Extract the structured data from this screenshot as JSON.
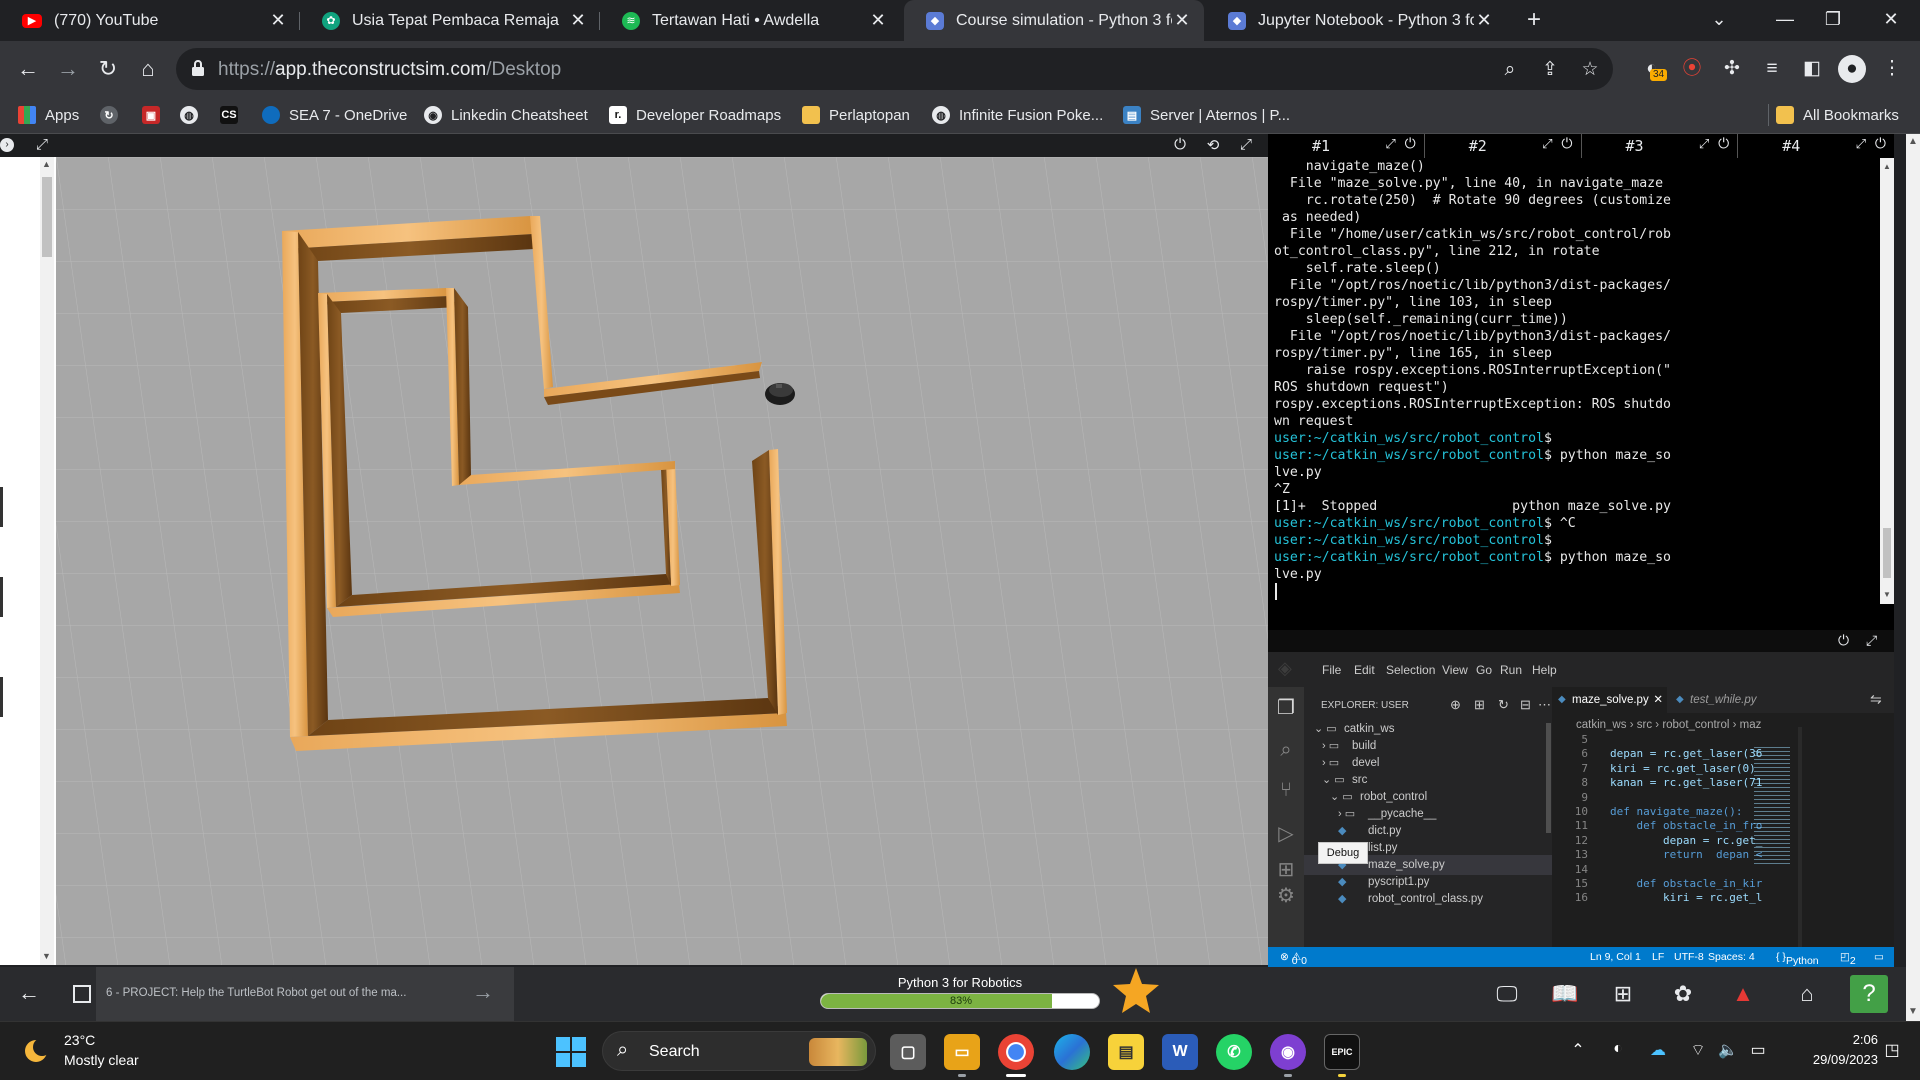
{
  "tabs": [
    {
      "title": "(770) YouTube",
      "icon": "youtube-icon",
      "active": false
    },
    {
      "title": "Usia Tepat Pembaca Remaja",
      "icon": "chatgpt-icon",
      "active": false
    },
    {
      "title": "Tertawan Hati • Awdella",
      "icon": "spotify-icon",
      "active": false
    },
    {
      "title": "Course simulation - Python 3 for",
      "icon": "theconstruct-icon",
      "active": true
    },
    {
      "title": "Jupyter Notebook - Python 3 for",
      "icon": "theconstruct-icon",
      "active": false
    }
  ],
  "address": {
    "scheme": "https://",
    "host": "app.theconstructsim.com",
    "path": "/Desktop"
  },
  "extension_badge": "34",
  "bookmarks": [
    {
      "label": "Apps",
      "icon": "apps-grid-icon"
    },
    {
      "label": "",
      "icon": "refresh-site-icon"
    },
    {
      "label": "",
      "icon": "red-site-icon"
    },
    {
      "label": "",
      "icon": "globe-icon"
    },
    {
      "label": "",
      "icon": "cs-site-icon"
    },
    {
      "label": "SEA 7 - OneDrive",
      "icon": "onedrive-icon"
    },
    {
      "label": "Linkedin Cheatsheet",
      "icon": "github-icon"
    },
    {
      "label": "Developer Roadmaps",
      "icon": "roadmap-icon"
    },
    {
      "label": "Perlaptopan",
      "icon": "folder-icon"
    },
    {
      "label": "Infinite Fusion Poke...",
      "icon": "globe-icon"
    },
    {
      "label": "Server | Aternos | P...",
      "icon": "aternos-icon"
    }
  ],
  "all_bookmarks": "All Bookmarks",
  "terminal": {
    "tabs": [
      "#1",
      "#2",
      "#3",
      "#4"
    ],
    "lines": [
      {
        "text": "    navigate_maze()"
      },
      {
        "text": "  File \"maze_solve.py\", line 40, in navigate_maze"
      },
      {
        "text": "    rc.rotate(250)  # Rotate 90 degrees (customize"
      },
      {
        "text": " as needed)"
      },
      {
        "text": "  File \"/home/user/catkin_ws/src/robot_control/rob"
      },
      {
        "text": "ot_control_class.py\", line 212, in rotate"
      },
      {
        "text": "    self.rate.sleep()"
      },
      {
        "text": "  File \"/opt/ros/noetic/lib/python3/dist-packages/"
      },
      {
        "text": "rospy/timer.py\", line 103, in sleep"
      },
      {
        "text": "    sleep(self._remaining(curr_time))"
      },
      {
        "text": "  File \"/opt/ros/noetic/lib/python3/dist-packages/"
      },
      {
        "text": "rospy/timer.py\", line 165, in sleep"
      },
      {
        "text": "    raise rospy.exceptions.ROSInterruptException(\""
      },
      {
        "text": "ROS shutdown request\")"
      },
      {
        "text": "rospy.exceptions.ROSInterruptException: ROS shutdo"
      },
      {
        "text": "wn request"
      },
      {
        "prompt": "user:~/catkin_ws/src/robot_control",
        "text": "$"
      },
      {
        "prompt": "user:~/catkin_ws/src/robot_control",
        "text": "$ python maze_so"
      },
      {
        "text": "lve.py"
      },
      {
        "text": "^Z"
      },
      {
        "text": "[1]+  Stopped                 python maze_solve.py"
      },
      {
        "prompt": "user:~/catkin_ws/src/robot_control",
        "text": "$ ^C"
      },
      {
        "prompt": "user:~/catkin_ws/src/robot_control",
        "text": "$"
      },
      {
        "prompt": "user:~/catkin_ws/src/robot_control",
        "text": "$ python maze_so"
      },
      {
        "text": "lve.py"
      }
    ]
  },
  "vscode": {
    "menu": [
      "File",
      "Edit",
      "Selection",
      "View",
      "Go",
      "Run",
      "Help"
    ],
    "explorer_title": "EXPLORER: USER",
    "tree": [
      {
        "label": "catkin_ws",
        "depth": 0,
        "kind": "folder-open"
      },
      {
        "label": "build",
        "depth": 1,
        "kind": "folder"
      },
      {
        "label": "devel",
        "depth": 1,
        "kind": "folder"
      },
      {
        "label": "src",
        "depth": 1,
        "kind": "folder-open"
      },
      {
        "label": "robot_control",
        "depth": 2,
        "kind": "folder-open"
      },
      {
        "label": "__pycache__",
        "depth": 3,
        "kind": "folder"
      },
      {
        "label": "dict.py",
        "depth": 3,
        "kind": "file"
      },
      {
        "label": "list.py",
        "depth": 3,
        "kind": "file"
      },
      {
        "label": "maze_solve.py",
        "depth": 3,
        "kind": "file",
        "selected": true
      },
      {
        "label": "pyscript1.py",
        "depth": 3,
        "kind": "file"
      },
      {
        "label": "robot_control_class.py",
        "depth": 3,
        "kind": "file"
      }
    ],
    "tabs": [
      {
        "label": "maze_solve.py",
        "active": true
      },
      {
        "label": "test_while.py",
        "active": false
      }
    ],
    "breadcrumb": [
      "catkin_ws",
      "src",
      "robot_control",
      "maz"
    ],
    "code": [
      {
        "n": "5",
        "text": ""
      },
      {
        "n": "6",
        "text": "depan = rc.get_laser(36"
      },
      {
        "n": "7",
        "text": "kiri = rc.get_laser(0)"
      },
      {
        "n": "8",
        "text": "kanan = rc.get_laser(71"
      },
      {
        "n": "9",
        "text": ""
      },
      {
        "n": "10",
        "text": "def navigate_maze():"
      },
      {
        "n": "11",
        "text": "    def obstacle_in_fro"
      },
      {
        "n": "12",
        "text": "        depan = rc.get_"
      },
      {
        "n": "13",
        "text": "        return  depan <"
      },
      {
        "n": "14",
        "text": ""
      },
      {
        "n": "15",
        "text": "    def obstacle_in_kir"
      },
      {
        "n": "16",
        "text": "        kiri = rc.get_l"
      }
    ],
    "tooltip": "Debug",
    "status": {
      "problems": "0",
      "warnings": "0",
      "position": "Ln 9, Col 1",
      "eol": "LF",
      "encoding": "UTF-8",
      "indent": "Spaces: 4",
      "language": "Python",
      "notifications": "2"
    }
  },
  "course": {
    "lesson": "6 - PROJECT: Help the TurtleBot Robot get out of the ma...",
    "title": "Python 3 for Robotics",
    "progress_label": "83%",
    "progress": 0.83
  },
  "taskbar": {
    "temperature": "23°C",
    "weather": "Mostly clear",
    "search": "Search",
    "time": "2:06",
    "date": "29/09/2023",
    "apps": [
      "widget-icon",
      "taskview-icon",
      "file-explorer-icon",
      "chrome-icon",
      "edge-icon",
      "sticky-notes-icon",
      "word-icon",
      "whatsapp-icon",
      "github-desktop-icon",
      "epic-games-icon"
    ]
  },
  "colors": {
    "chrome_dark": "#202124",
    "chrome_toolbar": "#35363a",
    "terminal_prompt": "#25c2d8",
    "vscode_status": "#007acc",
    "progress_green": "#7cb342",
    "maze_wood": "#c98a3c"
  }
}
